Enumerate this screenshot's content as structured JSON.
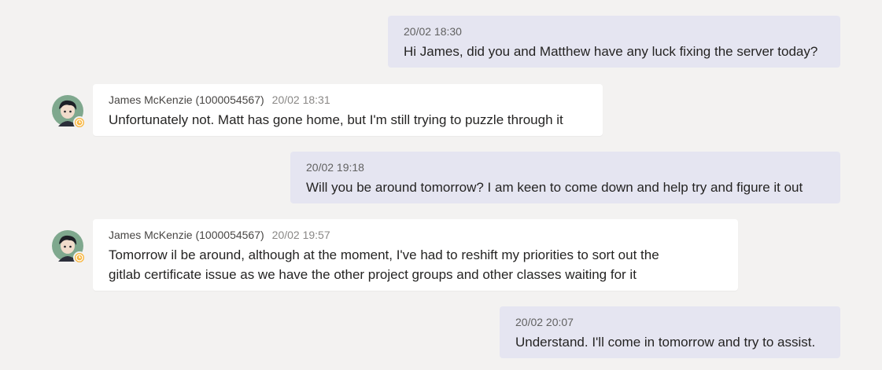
{
  "colors": {
    "background": "#f3f2f1",
    "sent_bubble": "#e5e5f1",
    "received_bubble": "#ffffff",
    "status_away": "#f8b63f"
  },
  "messages": [
    {
      "direction": "sent",
      "timestamp": "20/02 18:30",
      "text": "Hi James, did you and Matthew have any luck fixing the server today?"
    },
    {
      "direction": "received",
      "author": "James McKenzie (1000054567)",
      "timestamp": "20/02 18:31",
      "text": "Unfortunately not. Matt has gone home, but I'm still trying to puzzle through it",
      "avatar_icon": "user-avatar-icon",
      "status_icon": "clock-away-icon"
    },
    {
      "direction": "sent",
      "timestamp": "20/02 19:18",
      "text": "Will you be around tomorrow? I am keen to come down and help try and figure it out"
    },
    {
      "direction": "received",
      "author": "James McKenzie (1000054567)",
      "timestamp": "20/02 19:57",
      "text_lines": [
        "Tomorrow il be around, although at the moment, I've had to reshift my priorities to sort out the",
        "gitlab certificate issue as we have the other project groups and other classes waiting for it"
      ],
      "avatar_icon": "user-avatar-icon",
      "status_icon": "clock-away-icon"
    },
    {
      "direction": "sent",
      "timestamp": "20/02 20:07",
      "text": "Understand. I'll come in tomorrow and try to assist."
    }
  ]
}
